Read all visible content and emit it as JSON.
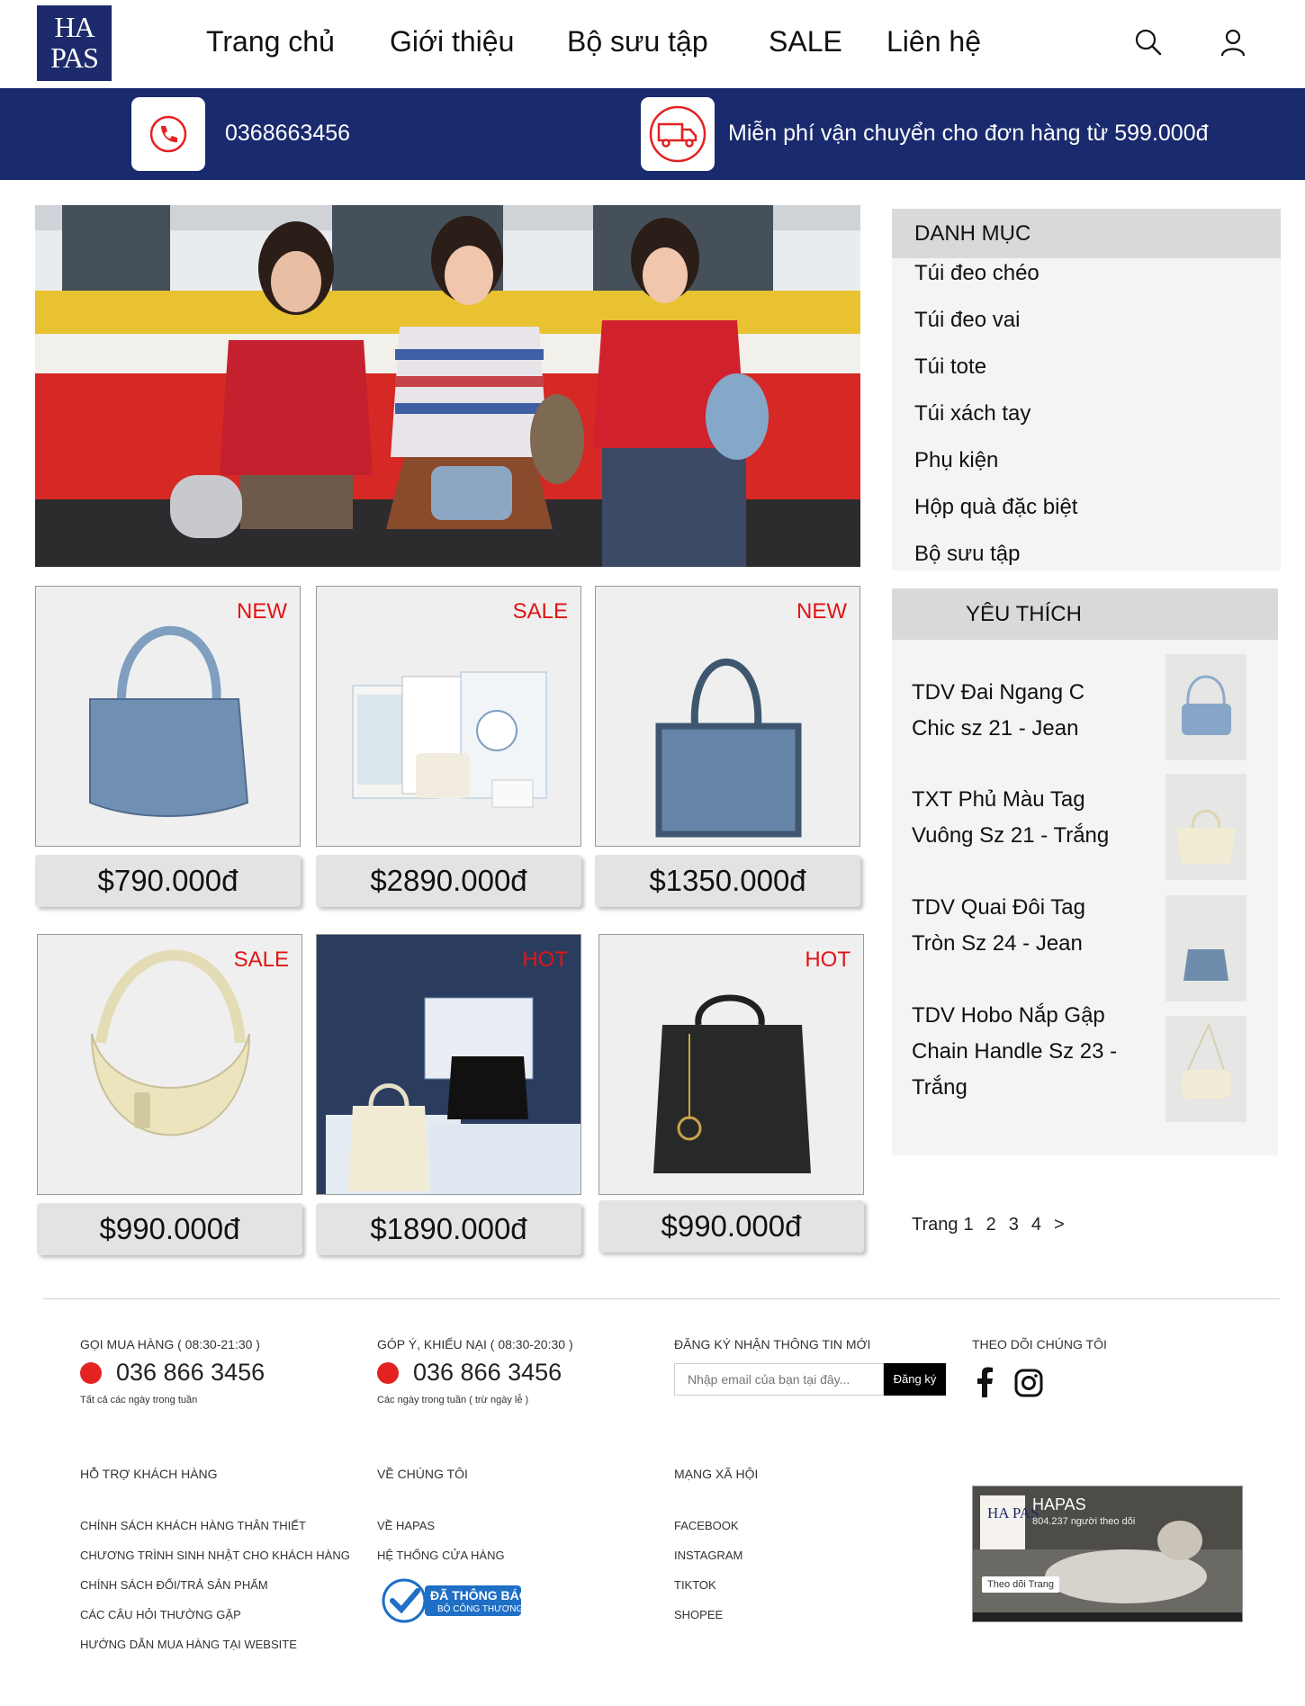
{
  "header": {
    "logo_text": "HA PAS",
    "nav": [
      "Trang chủ",
      "Giới thiệu",
      "Bộ sưu tập",
      "SALE",
      "Liên hệ"
    ]
  },
  "topbar": {
    "phone": "0368663456",
    "shipping": "Miễn phí vận chuyển cho đơn hàng từ 599.000đ"
  },
  "products": [
    {
      "badge": "NEW",
      "price": "$790.000đ"
    },
    {
      "badge": "SALE",
      "price": "$2890.000đ"
    },
    {
      "badge": "NEW",
      "price": "$1350.000đ"
    },
    {
      "badge": "SALE",
      "price": "$990.000đ"
    },
    {
      "badge": "HOT",
      "price": "$1890.000đ"
    },
    {
      "badge": "HOT",
      "price": "$990.000đ"
    }
  ],
  "categories": {
    "title": "DANH MỤC",
    "items": [
      "Túi đeo chéo",
      "Túi đeo vai",
      "Túi tote",
      "Túi xách tay",
      "Phụ kiện",
      "Hộp quà đặc biệt",
      "Bộ sưu tập"
    ]
  },
  "favorites": {
    "title": "YÊU THÍCH",
    "items": [
      "TDV Đai Ngang C Chic sz 21 - Jean",
      "TXT Phủ Màu Tag Vuông Sz 21 - Trắng",
      "TDV Quai Đôi Tag Tròn Sz 24 - Jean",
      "TDV Hobo Nắp Gập Chain Handle Sz 23 - Trắng"
    ]
  },
  "pager": {
    "label": "Trang",
    "pages": [
      "1",
      "2",
      "3",
      "4"
    ],
    "next": ">"
  },
  "footer": {
    "buy_head": "GỌI MUA HÀNG ( 08:30-21:30 )",
    "buy_phone": "036 866 3456",
    "buy_note": "Tất cả các ngày trong tuần",
    "feedback_head": "GÓP Ý, KHIẾU NẠI ( 08:30-20:30 )",
    "feedback_phone": "036 866 3456",
    "feedback_note": "Các ngày trong tuần ( trừ ngày lễ )",
    "newsletter_head": "ĐĂNG KÝ NHẬN THÔNG TIN MỚI",
    "email_placeholder": "Nhập email của bạn tại đây...",
    "subscribe": "Đăng ký",
    "follow_head": "THEO DÕI CHÚNG TÔI",
    "support_head": "HỖ TRỢ KHÁCH HÀNG",
    "support_links": [
      "CHÍNH SÁCH KHÁCH HÀNG THÂN THIẾT",
      "CHƯƠNG TRÌNH SINH NHẬT CHO KHÁCH HÀNG",
      "CHÍNH SÁCH ĐỔI/TRẢ SẢN PHẨM",
      "CÁC CÂU HỎI THƯỜNG GẶP",
      "HƯỚNG DẪN MUA HÀNG TẠI WEBSITE"
    ],
    "about_head": "VỀ CHÚNG TÔI",
    "about_links": [
      "VỀ HAPAS",
      "HỆ THỐNG CỬA HÀNG"
    ],
    "badge_line1": "ĐÃ THÔNG BÁO",
    "badge_line2": "BỘ CÔNG THƯƠNG",
    "social_head": "MẠNG XÃ HỘI",
    "social_links": [
      "FACEBOOK",
      "INSTAGRAM",
      "TIKTOK",
      "SHOPEE"
    ],
    "fb_name": "HAPAS",
    "fb_followers": "804.237 người theo dõi",
    "fb_follow_btn": "Theo dõi Trang"
  },
  "colors": {
    "brand_navy": "#1a2a6e",
    "badge_red": "#e01515",
    "panel_grey": "#d9d9d9"
  }
}
